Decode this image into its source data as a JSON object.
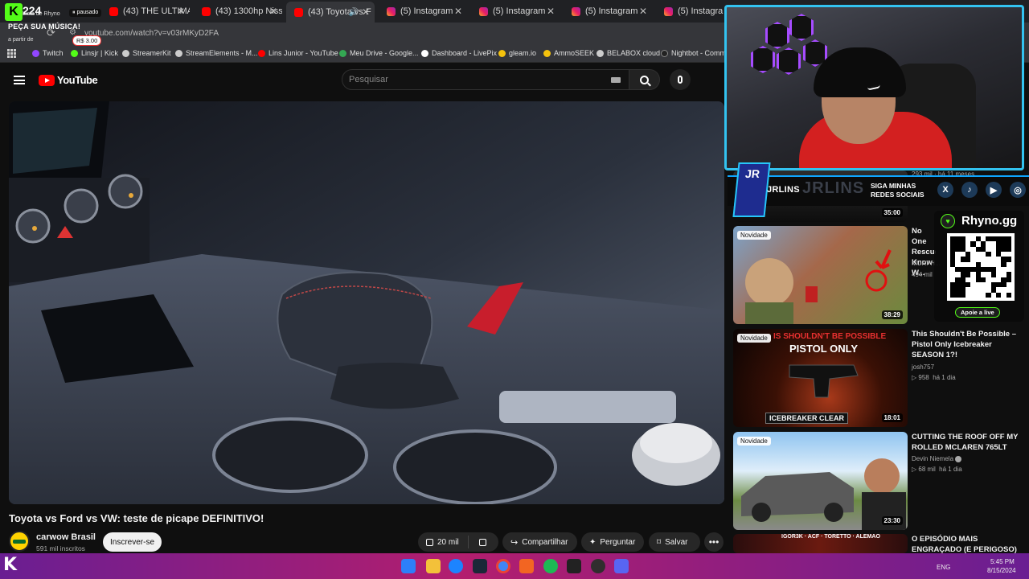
{
  "browser": {
    "tabs": [
      {
        "label": "(43) THE ULTIMATE",
        "favicon": "youtube-icon"
      },
      {
        "label": "(43) 1300hp Nissan",
        "favicon": "youtube-icon"
      },
      {
        "label": "(43) Toyota vs F",
        "favicon": "youtube-icon",
        "active": true
      },
      {
        "label": "(5) Instagram",
        "favicon": "instagram-icon"
      },
      {
        "label": "(5) Instagram",
        "favicon": "instagram-icon"
      },
      {
        "label": "(5) Instagram",
        "favicon": "instagram-icon"
      },
      {
        "label": "(5) Instagram",
        "favicon": "instagram-icon"
      }
    ],
    "url": "youtube.com/watch?v=v03rMKyD2FA",
    "bookmarks": [
      {
        "label": "Twitch",
        "color": "#9146ff"
      },
      {
        "label": "Linsjr | Kick",
        "color": "#53fc18"
      },
      {
        "label": "StreamerKit",
        "color": "#cccccc"
      },
      {
        "label": "StreamElements - M...",
        "color": "#cccccc"
      },
      {
        "label": "Lins Junior - YouTube",
        "color": "#ff0000"
      },
      {
        "label": "Meu Drive - Google...",
        "color": "#34a853"
      },
      {
        "label": "Dashboard - LivePix",
        "color": "#ffffff"
      },
      {
        "label": "gleam.io",
        "color": "#f4c20d"
      },
      {
        "label": "AmmoSEEK",
        "color": "#f4c20d"
      },
      {
        "label": "BELABOX cloud",
        "color": "#cccccc"
      },
      {
        "label": "Nightbot - Comm",
        "color": "#111111"
      }
    ]
  },
  "stream_overlay": {
    "viewer_count": "224",
    "sub_name": "Lista de Rhyno",
    "paused": "pausado",
    "song_request": "PEÇA SUA MÚSICA!",
    "from_label": "a partir de",
    "price": "R$ 3.00",
    "social_name": "JRLINS",
    "follow_text_1": "SIGA MINHAS",
    "follow_text_2": "REDES SOCIAIS",
    "socials": [
      "X",
      "TikTok",
      "YouTube",
      "Instagram"
    ],
    "rhyno_label": "Rhyno.gg",
    "support_label": "Apoie a live"
  },
  "youtube": {
    "logo": "YouTube",
    "search_placeholder": "Pesquisar",
    "video": {
      "title": "Toyota vs Ford vs VW: teste de picape DEFINITIVO!",
      "channel": "carwow Brasil",
      "subscribers": "591 mil inscritos",
      "subscribe_label": "Inscrever-se",
      "likes": "20 mil",
      "share_label": "Compartilhar",
      "ask_label": "Perguntar",
      "save_label": "Salvar"
    },
    "recommendations": [
      {
        "title": "",
        "channel": "",
        "stats": "293 mil · há 11 meses",
        "duration": "35:00"
      },
      {
        "title": "No One Rescue... Know W...",
        "channel": "MURPH...",
        "stats": "494 mil",
        "duration": "38:29",
        "badge": "Novidade"
      },
      {
        "title": "This Shouldn't Be Possible – Pistol Only Icebreaker SEASON 1?!",
        "channel": "josh757",
        "views": "958",
        "age": "há 1 dia",
        "duration": "18:01",
        "badge": "Novidade"
      },
      {
        "title": "CUTTING THE ROOF OFF MY ROLLED MCLAREN 765LT",
        "channel": "Devin Niemela",
        "views": "68 mil",
        "age": "há 1 dia",
        "duration": "23:30",
        "badge": "Novidade"
      },
      {
        "title": "O EPISÓDIO MAIS ENGRAÇADO (E PERIGOSO)",
        "channel": "",
        "stats": "",
        "duration": ""
      }
    ],
    "thumb_texts": {
      "pistol_top": "IS SHOULDN'T BE POSSIBLE",
      "pistol_big": "PISTOL ONLY",
      "pistol_bottom": "ICEBREAKER CLEAR",
      "last_thumb": "IGOR3K · ACF · TORETTO · ALEMÃO"
    }
  },
  "taskbar": {
    "lang": "ENG",
    "time": "5:45 PM",
    "date": "8/15/2024"
  }
}
